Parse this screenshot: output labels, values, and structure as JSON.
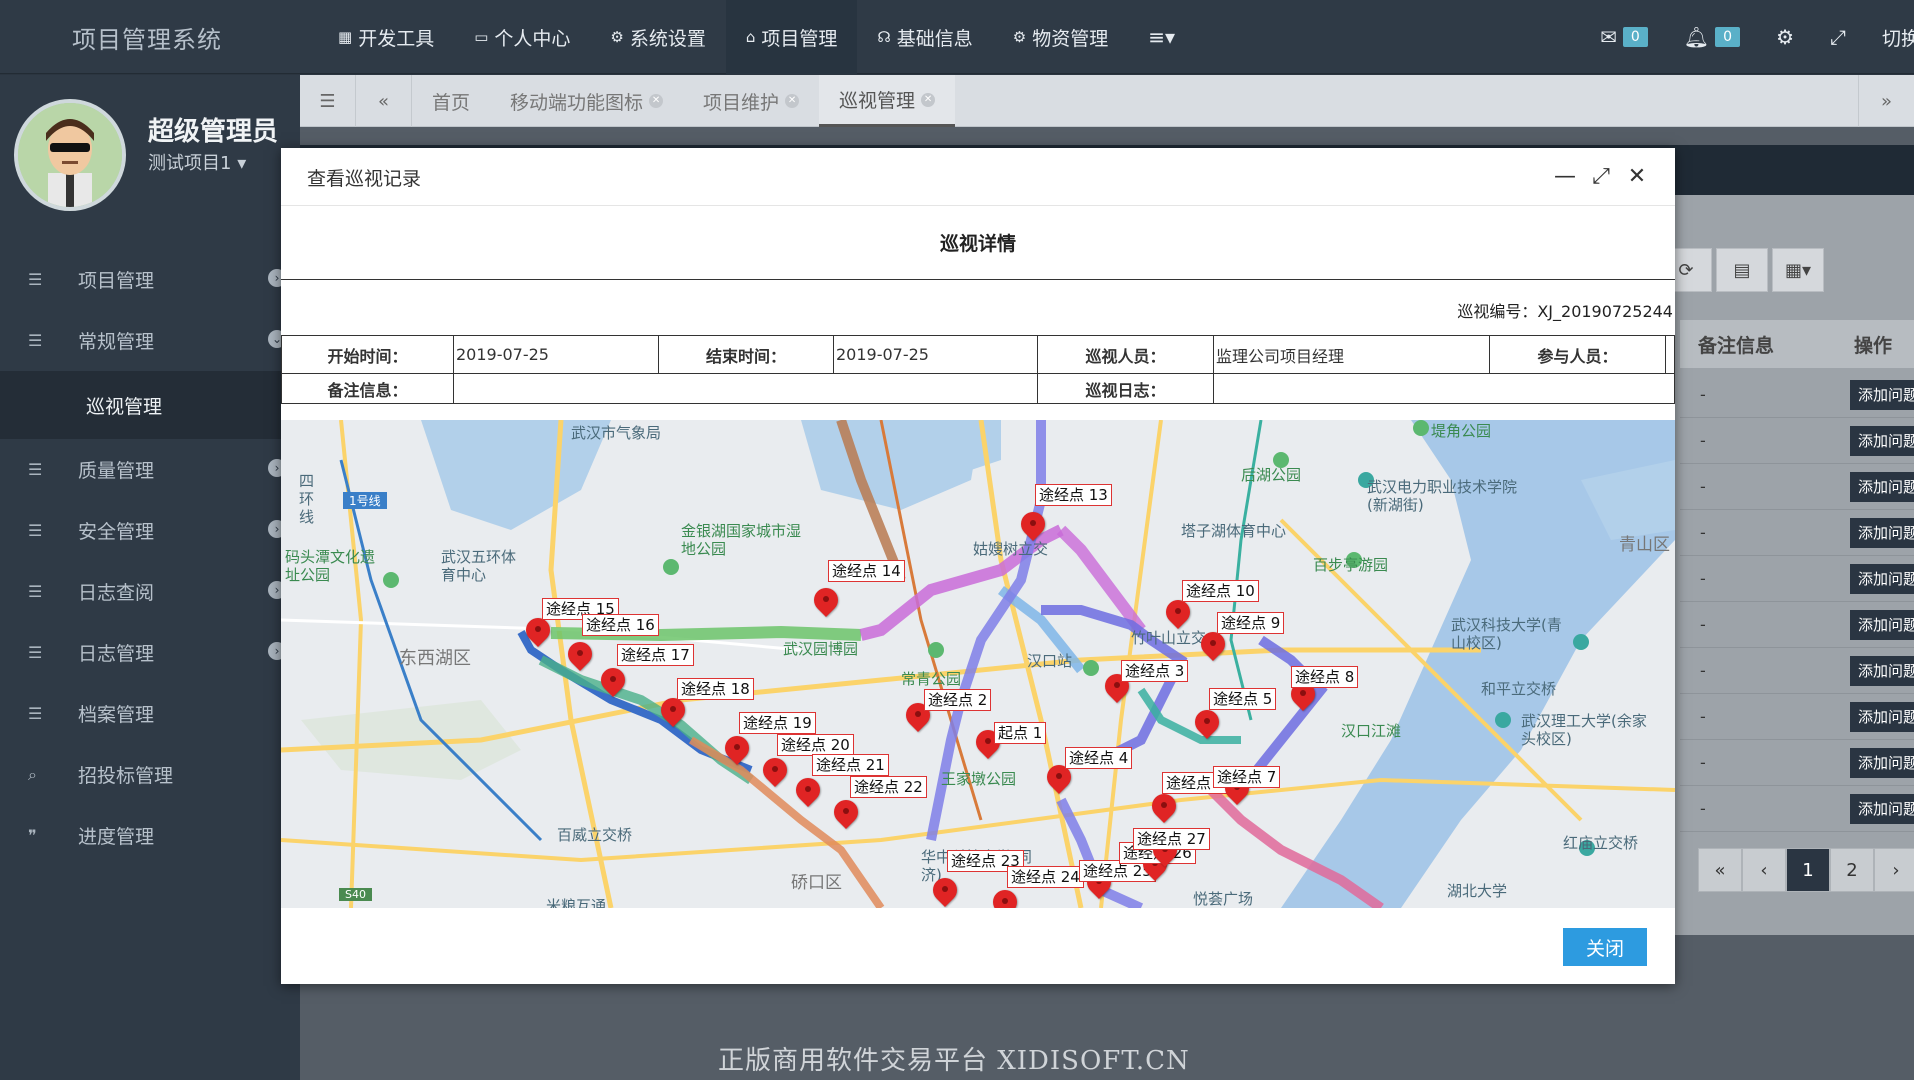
{
  "app": {
    "title": "项目管理系统"
  },
  "topnav": [
    {
      "label": "开发工具",
      "icon": "grid-icon"
    },
    {
      "label": "个人中心",
      "icon": "monitor-icon"
    },
    {
      "label": "系统设置",
      "icon": "gear-icon"
    },
    {
      "label": "项目管理",
      "icon": "home-icon"
    },
    {
      "label": "基础信息",
      "icon": "headset-icon"
    },
    {
      "label": "物资管理",
      "icon": "cogs-icon"
    }
  ],
  "topright": {
    "mail_count": "0",
    "bell_count": "0",
    "switch_label": "切换"
  },
  "user": {
    "name": "超级管理员",
    "project": "测试项目1"
  },
  "sidebar": {
    "items": [
      {
        "label": "项目管理"
      },
      {
        "label": "常规管理"
      },
      {
        "label": "巡视管理"
      },
      {
        "label": "质量管理"
      },
      {
        "label": "安全管理"
      },
      {
        "label": "日志查阅"
      },
      {
        "label": "日志管理"
      },
      {
        "label": "档案管理"
      },
      {
        "label": "招投标管理"
      },
      {
        "label": "进度管理"
      }
    ]
  },
  "tabs": [
    {
      "label": "首页"
    },
    {
      "label": "移动端功能图标"
    },
    {
      "label": "项目维护"
    },
    {
      "label": "巡视管理"
    }
  ],
  "bgtable": {
    "headers": [
      "备注信息",
      "操作"
    ],
    "row_dash": "-",
    "row_action": "添加问题",
    "pages": [
      "«",
      "‹",
      "1",
      "2",
      "›"
    ]
  },
  "modal": {
    "title": "查看巡视记录",
    "detail_title": "巡视详情",
    "record_no": "巡视编号：XJ_20190725244",
    "start_label": "开始时间：",
    "start_value": "2019-07-25",
    "end_label": "结束时间：",
    "end_value": "2019-07-25",
    "inspector_label": "巡视人员：",
    "inspector_value": "监理公司项目经理",
    "participants_label": "参与人员：",
    "participants_value": "",
    "remark_label": "备注信息：",
    "remark_value": "",
    "log_label": "巡视日志：",
    "log_value": "",
    "close_label": "关闭"
  },
  "map": {
    "places": [
      "武汉市气象局",
      "四环线",
      "1号线",
      "码头潭文化遗址公园",
      "武汉五环体育中心",
      "东西湖区",
      "金银湖国家城市湿地公园",
      "武汉园博园",
      "姑嫂树立交",
      "常青公园",
      "汉口站",
      "竹叶山立交",
      "塔子湖体育中心",
      "后湖公园",
      "堤角公园",
      "武汉电力职业技术学院(新湖街)",
      "百步亭游园",
      "青山区",
      "武汉科技大学(青山校区)",
      "和平立交桥",
      "武汉理工大学(余家头校区)",
      "汉口江滩",
      "王家墩公园",
      "百威立交桥",
      "硚口区",
      "华中科技大学(同济)",
      "红庙立交桥",
      "湖北大学",
      "悦荟广场",
      "S40",
      "米粮互通"
    ],
    "waypoints": [
      "起点 1",
      "途经点 2",
      "途经点 3",
      "途经点 4",
      "途经点 5",
      "途经点 6",
      "途经点 7",
      "途经点 8",
      "途经点 9",
      "途经点 10",
      "途经点 13",
      "途经点 14",
      "途经点 15",
      "途经点 16",
      "途经点 17",
      "途经点 18",
      "途经点 19",
      "途经点 20",
      "途经点 21",
      "途经点 22",
      "途经点 23",
      "途经点 24",
      "途经点 25",
      "途经点 26",
      "途经点 27"
    ]
  },
  "watermark": "正版商用软件交易平台 XIDISOFT.CN"
}
